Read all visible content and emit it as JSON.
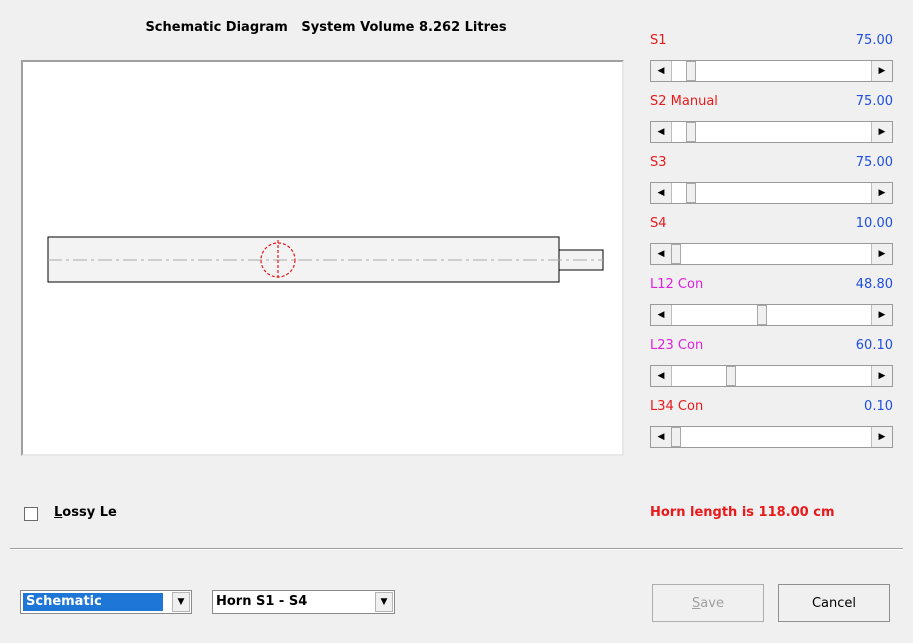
{
  "header": {
    "title": "Schematic Diagram   System Volume 8.262 Litres"
  },
  "sliders": [
    {
      "label": "S1",
      "value": "75.00",
      "label_color": "#e8191b",
      "position": 0.08
    },
    {
      "label": "S2  Manual",
      "value": "75.00",
      "label_color": "#e8191b",
      "position": 0.08
    },
    {
      "label": "S3",
      "value": "75.00",
      "label_color": "#e8191b",
      "position": 0.08
    },
    {
      "label": "S4",
      "value": "10.00",
      "label_color": "#e8191b",
      "position": 0.0
    },
    {
      "label": "L12  Con",
      "value": "48.80",
      "label_color": "#e020e0",
      "position": 0.45
    },
    {
      "label": "L23  Con",
      "value": "60.10",
      "label_color": "#e020e0",
      "position": 0.29
    },
    {
      "label": "L34  Con",
      "value": "0.10",
      "label_color": "#e8191b",
      "position": 0.0
    }
  ],
  "checkbox": {
    "label_underlined": "L",
    "label_rest": "ossy Le",
    "checked": false
  },
  "status": {
    "horn_length": "Horn length is 118.00 cm"
  },
  "combos": {
    "view": "Schematic",
    "section": "Horn S1 - S4"
  },
  "buttons": {
    "save": "Save",
    "save_underlined": "S",
    "save_rest": "ave",
    "cancel": "Cancel"
  },
  "icons": {
    "scroll_left": "arrow-left-icon",
    "scroll_right": "arrow-right-icon",
    "dropdown": "chevron-down-icon"
  },
  "colors": {
    "label_red": "#e8191b",
    "label_magenta": "#e020e0",
    "value_blue": "#1f4fe0",
    "selection": "#1e76d6"
  }
}
